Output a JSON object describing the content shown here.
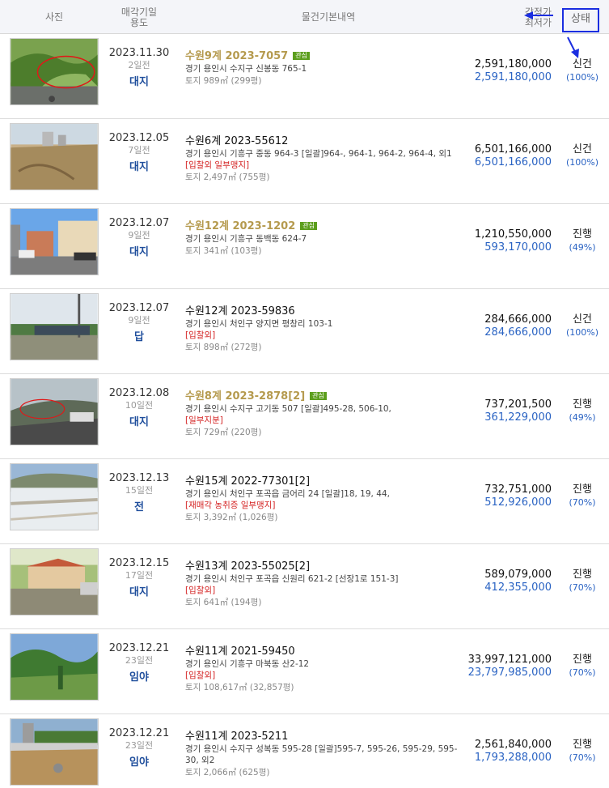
{
  "header": {
    "photo": "사진",
    "date_line1": "매각기일",
    "date_line2": "용도",
    "desc": "물건기본내역",
    "price_line1": "감정가",
    "price_line2": "최저가",
    "status": "상태"
  },
  "rows": [
    {
      "date": "2023.11.30",
      "days": "2일전",
      "use": "대지",
      "case": "수원9계 2023-7057",
      "highlight": true,
      "badge": "관심",
      "address": "경기 용인시 수지구 신봉동 765-1",
      "tags": "",
      "area": "토지 989㎡ (299평)",
      "appraisal": "2,591,180,000",
      "minimum": "2,591,180,000",
      "status": "신건",
      "pct": "(100%)"
    },
    {
      "date": "2023.12.05",
      "days": "7일전",
      "use": "대지",
      "case": "수원6계 2023-55612",
      "highlight": false,
      "badge": "",
      "address": "경기 용인시 기흥구 중동 964-3 [일괄]964-, 964-1, 964-2, 964-4, 외1",
      "tags": "[입찰외   일부맹지]",
      "area": "토지 2,497㎡ (755평)",
      "appraisal": "6,501,166,000",
      "minimum": "6,501,166,000",
      "status": "신건",
      "pct": "(100%)"
    },
    {
      "date": "2023.12.07",
      "days": "9일전",
      "use": "대지",
      "case": "수원12계 2023-1202",
      "highlight": true,
      "badge": "관심",
      "address": "경기 용인시 기흥구 동백동 624-7",
      "tags": "",
      "area": "토지 341㎡ (103평)",
      "appraisal": "1,210,550,000",
      "minimum": "593,170,000",
      "status": "진행",
      "pct": "(49%)"
    },
    {
      "date": "2023.12.07",
      "days": "9일전",
      "use": "답",
      "case": "수원12계 2023-59836",
      "highlight": false,
      "badge": "",
      "address": "경기 용인시 처인구 양지면 평창리 103-1",
      "tags": "[입찰외]",
      "area": "토지 898㎡ (272평)",
      "appraisal": "284,666,000",
      "minimum": "284,666,000",
      "status": "신건",
      "pct": "(100%)"
    },
    {
      "date": "2023.12.08",
      "days": "10일전",
      "use": "대지",
      "case": "수원8계 2023-2878[2]",
      "highlight": true,
      "badge": "관심",
      "address": "경기 용인시 수지구 고기동 507 [일괄]495-28, 506-10,",
      "tags": "[일부지분]",
      "area": "토지 729㎡ (220평)",
      "appraisal": "737,201,500",
      "minimum": "361,229,000",
      "status": "진행",
      "pct": "(49%)"
    },
    {
      "date": "2023.12.13",
      "days": "15일전",
      "use": "전",
      "case": "수원15계 2022-77301[2]",
      "highlight": false,
      "badge": "",
      "address": "경기 용인시 처인구 포곡읍 금어리 24 [일괄]18, 19, 44,",
      "tags": "[재매각   농취증   일부맹지]",
      "area": "토지 3,392㎡ (1,026평)",
      "appraisal": "732,751,000",
      "minimum": "512,926,000",
      "status": "진행",
      "pct": "(70%)"
    },
    {
      "date": "2023.12.15",
      "days": "17일전",
      "use": "대지",
      "case": "수원13계 2023-55025[2]",
      "highlight": false,
      "badge": "",
      "address": "경기 용인시 처인구 포곡읍 신원리 621-2 [선장1로 151-3]",
      "tags": "[입찰외]",
      "area": "토지 641㎡ (194평)",
      "appraisal": "589,079,000",
      "minimum": "412,355,000",
      "status": "진행",
      "pct": "(70%)"
    },
    {
      "date": "2023.12.21",
      "days": "23일전",
      "use": "임야",
      "case": "수원11계 2021-59450",
      "highlight": false,
      "badge": "",
      "address": "경기 용인시 기흥구 마북동 산2-12",
      "tags": "[입찰외]",
      "area": "토지 108,617㎡ (32,857평)",
      "appraisal": "33,997,121,000",
      "minimum": "23,797,985,000",
      "status": "진행",
      "pct": "(70%)"
    },
    {
      "date": "2023.12.21",
      "days": "23일전",
      "use": "임야",
      "case": "수원11계 2023-5211",
      "highlight": false,
      "badge": "",
      "address": "경기 용인시 수지구 성복동 595-28 [일괄]595-7, 595-26, 595-29, 595-30, 외2",
      "tags": "",
      "area": "토지 2,066㎡ (625평)",
      "appraisal": "2,561,840,000",
      "minimum": "1,793,288,000",
      "status": "진행",
      "pct": "(70%)"
    }
  ],
  "colors": {
    "accent_blue": "#2a63c3",
    "use_blue": "#1f4e9c",
    "highlight_gold": "#b59a4e",
    "badge_green": "#5c9e1d",
    "tag_red": "#d42222",
    "annotation_blue": "#1b2ee0"
  }
}
